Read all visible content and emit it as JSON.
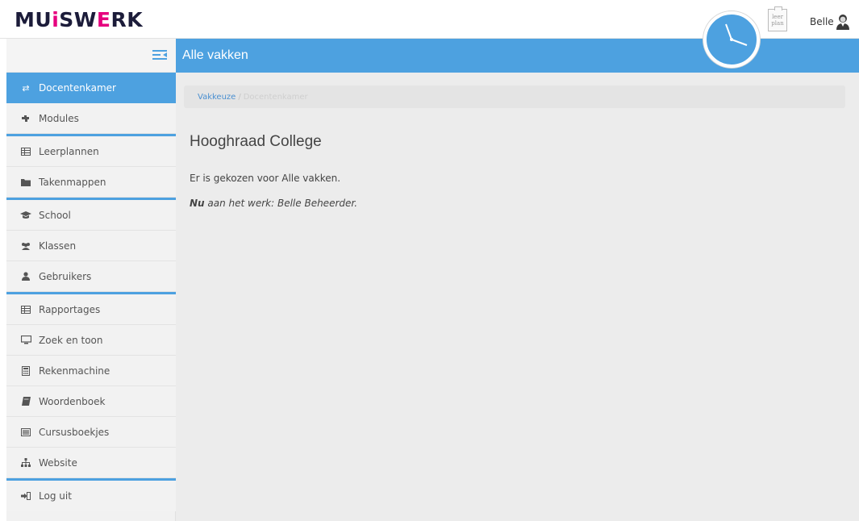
{
  "header": {
    "logo_part1": "MU",
    "logo_part2": "i",
    "logo_part3": "SW",
    "logo_part4": "E",
    "logo_part5": "RK",
    "leerplan_icon_text": "leer plan",
    "user_name": "Belle"
  },
  "sidebar": {
    "items": [
      {
        "label": "Docentenkamer",
        "icon": "exchange-icon",
        "active": true
      },
      {
        "label": "Modules",
        "icon": "puzzle-icon",
        "active": false
      },
      {
        "label": "Leerplannen",
        "icon": "table-icon",
        "active": false
      },
      {
        "label": "Takenmappen",
        "icon": "folder-icon",
        "active": false
      },
      {
        "label": "School",
        "icon": "graduation-cap-icon",
        "active": false
      },
      {
        "label": "Klassen",
        "icon": "users-icon",
        "active": false
      },
      {
        "label": "Gebruikers",
        "icon": "user-icon",
        "active": false
      },
      {
        "label": "Rapportages",
        "icon": "table-icon",
        "active": false
      },
      {
        "label": "Zoek en toon",
        "icon": "monitor-icon",
        "active": false
      },
      {
        "label": "Rekenmachine",
        "icon": "calculator-icon",
        "active": false
      },
      {
        "label": "Woordenboek",
        "icon": "book-icon",
        "active": false
      },
      {
        "label": "Cursusboekjes",
        "icon": "list-icon",
        "active": false
      },
      {
        "label": "Website",
        "icon": "sitemap-icon",
        "active": false
      },
      {
        "label": "Log uit",
        "icon": "logout-icon",
        "active": false
      }
    ]
  },
  "title_bar": {
    "title": "Alle vakken"
  },
  "breadcrumb": {
    "link": "Vakkeuze",
    "separator": "/",
    "current": "Docentenkamer"
  },
  "main": {
    "school_name": "Hooghraad College",
    "line1": "Er is gekozen voor Alle vakken.",
    "line2_bold": "Nu",
    "line2_rest": " aan het werk: Belle Beheerder."
  },
  "colors": {
    "accent": "#4da1e0",
    "logo_dark": "#1c1c3a",
    "logo_pink": "#e6007e"
  }
}
